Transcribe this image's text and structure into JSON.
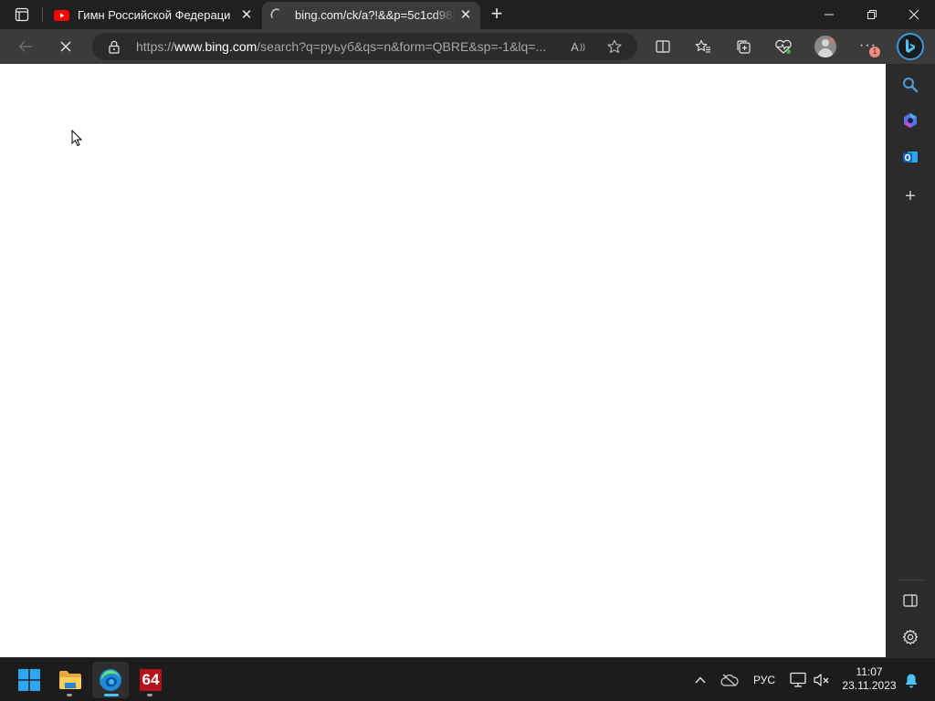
{
  "tabs": [
    {
      "title": "Гимн Российской Федерации - ",
      "favicon": "youtube-icon"
    },
    {
      "title": "bing.com/ck/a?!&&p=5c1cd98b",
      "favicon": "loading-spinner-icon",
      "active": true
    }
  ],
  "address": {
    "url_prefix": "https://",
    "url_domain": "www.bing.com",
    "url_rest": "/search?q=руьуб&qs=n&form=QBRE&sp=-1&lq=..."
  },
  "toolbar": {
    "notification_badge": "1"
  },
  "taskbar": {
    "language": "РУС",
    "time": "11:07",
    "date": "23.11.2023",
    "app_64_label": "64"
  },
  "colors": {
    "chrome_dark": "#202020",
    "toolbar": "#3b3b3b",
    "youtube_red": "#ff0000",
    "accent_blue": "#4cc2ff"
  }
}
